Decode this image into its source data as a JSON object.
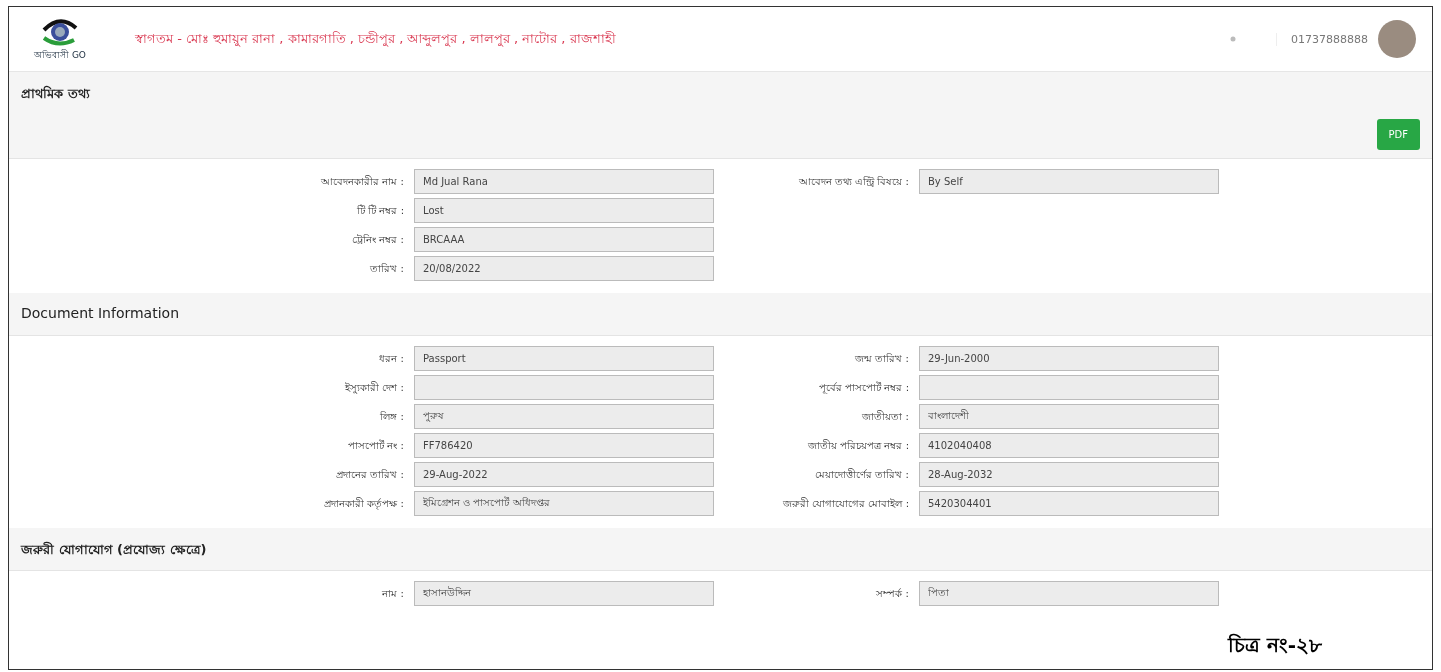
{
  "header": {
    "logo_text": "অভিবাসী GO",
    "welcome": "স্বাগতম - মোঃ হুমায়ুন রানা , কামারগাতি , চন্ডীপুর , আব্দুলপুর , লালপুর , নাটোর , রাজশাহী",
    "phone": "01737888888"
  },
  "sections": [
    {
      "title": "প্রাথমিক তথ্য",
      "button": "PDF",
      "left": [
        {
          "label": "আবেদনকারীর নাম :",
          "value": "Md Jual Rana"
        },
        {
          "label": "টি টি নম্বর :",
          "value": "Lost"
        },
        {
          "label": "ট্রেনিং নম্বর :",
          "value": "BRCAAA"
        },
        {
          "label": "তারিখ :",
          "value": "20/08/2022"
        }
      ],
      "right": [
        {
          "label": "আবেদন তথ্য এন্ট্রি বিষয়ে :",
          "value": "By Self"
        }
      ]
    },
    {
      "title": "Document Information",
      "left": [
        {
          "label": "ধরন :",
          "value": "Passport"
        },
        {
          "label": "ইস্যুকারী দেশ :"
        },
        {
          "label": "লিঙ্গ :",
          "value": "পুরুষ"
        },
        {
          "label": "পাসপোর্ট নং :",
          "value": "FF786420"
        },
        {
          "label": "প্রদানের তারিখ :",
          "value": "29-Aug-2022"
        },
        {
          "label": "প্রদানকারী কর্তৃপক্ষ :",
          "value": "ইমিগ্রেশন ও পাসপোর্ট অধিদপ্তর"
        }
      ],
      "right": [
        {
          "label": "জন্ম তারিখ :",
          "value": "29-Jun-2000"
        },
        {
          "label": "পূর্বের পাসপোর্ট নম্বর :"
        },
        {
          "label": "জাতীয়তা :",
          "value": "বাংলাদেশী"
        },
        {
          "label": "জাতীয় পরিচয়পত্র নম্বর :",
          "value": "4102040408"
        },
        {
          "label": "মেয়াদোত্তীর্ণের তারিখ :",
          "value": "28-Aug-2032"
        },
        {
          "label": "জরুরী যোগাযোগের মোবাইল :",
          "value": "5420304401"
        }
      ]
    },
    {
      "title": "জরুরী যোগাযোগ (প্রযোজ্য ক্ষেত্রে)",
      "left": [
        {
          "label": "নাম :",
          "value": "হাসানউদ্দিন"
        }
      ],
      "right": [
        {
          "label": "সম্পর্ক :",
          "value": "পিতা"
        }
      ]
    }
  ],
  "caption": "চিত্র নং-২৮"
}
